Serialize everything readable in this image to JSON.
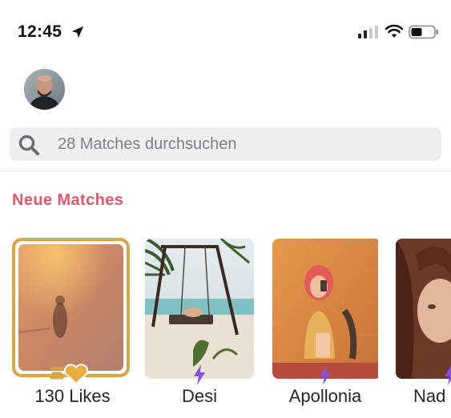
{
  "status_bar": {
    "time": "12:45",
    "icons": [
      "location-arrow-icon",
      "cellular-signal-icon",
      "wifi-icon",
      "battery-icon"
    ]
  },
  "profile": {
    "avatar": "user-avatar"
  },
  "search": {
    "placeholder": "28 Matches durchsuchen",
    "value": ""
  },
  "section": {
    "title": "Neue Matches"
  },
  "matches": [
    {
      "label": "130 Likes",
      "type": "likes"
    },
    {
      "label": "Desi",
      "boosted": true
    },
    {
      "label": "Apollonia",
      "boosted": true
    },
    {
      "label": "Nad",
      "boosted": true
    }
  ],
  "colors": {
    "accent": "#e5566a",
    "gold": "#d8a547",
    "boost": "#8a4ee8",
    "search_bg": "#efefef"
  }
}
